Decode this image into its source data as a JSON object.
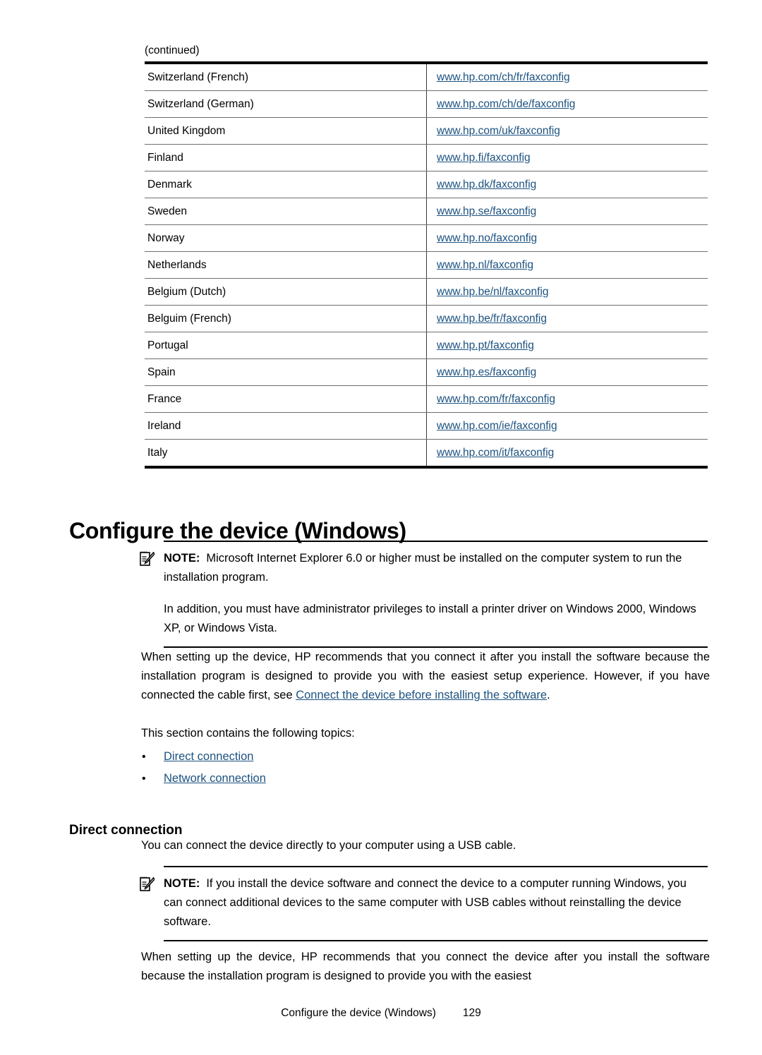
{
  "document": {
    "continued_label": "(continued)",
    "page_heading": "Configure the device (Windows)",
    "sub_heading": "Direct connection",
    "footer_title": "Configure the device (Windows)",
    "footer_page_number": "129",
    "link_color": "#1c5280",
    "text_color": "#000000",
    "background_color": "#ffffff"
  },
  "fax_table": {
    "rows": [
      {
        "country": "Switzerland (French)",
        "url": "www.hp.com/ch/fr/faxconfig"
      },
      {
        "country": "Switzerland (German)",
        "url": "www.hp.com/ch/de/faxconfig"
      },
      {
        "country": "United Kingdom",
        "url": "www.hp.com/uk/faxconfig"
      },
      {
        "country": "Finland",
        "url": "www.hp.fi/faxconfig"
      },
      {
        "country": "Denmark",
        "url": "www.hp.dk/faxconfig"
      },
      {
        "country": "Sweden",
        "url": "www.hp.se/faxconfig"
      },
      {
        "country": "Norway",
        "url": "www.hp.no/faxconfig"
      },
      {
        "country": "Netherlands",
        "url": "www.hp.nl/faxconfig"
      },
      {
        "country": "Belgium (Dutch)",
        "url": "www.hp.be/nl/faxconfig"
      },
      {
        "country": "Belguim (French)",
        "url": "www.hp.be/fr/faxconfig"
      },
      {
        "country": "Portugal",
        "url": "www.hp.pt/faxconfig"
      },
      {
        "country": "Spain",
        "url": "www.hp.es/faxconfig"
      },
      {
        "country": "France",
        "url": "www.hp.com/fr/faxconfig"
      },
      {
        "country": "Ireland",
        "url": "www.hp.com/ie/faxconfig"
      },
      {
        "country": "Italy",
        "url": "www.hp.com/it/faxconfig"
      }
    ]
  },
  "note_one": {
    "icon": "note-pencil-icon",
    "label": "NOTE:",
    "paragraph_1": "Microsoft Internet Explorer 6.0 or higher must be installed on the computer system to run the installation program.",
    "paragraph_2": "In addition, you must have administrator privileges to install a printer driver on Windows 2000, Windows XP, or Windows Vista."
  },
  "intro": {
    "text_before_link": "When setting up the device, HP recommends that you connect it after you install the software because the installation program is designed to provide you with the easiest setup experience. However, if you have connected the cable first, see ",
    "link_text": "Connect the device before installing the software",
    "text_after_link": ".",
    "topics_intro": "This section contains the following topics:"
  },
  "topics": {
    "bullet_glyph": "•",
    "items": [
      {
        "label": "Direct connection"
      },
      {
        "label": "Network connection"
      }
    ]
  },
  "direct_connection": {
    "intro": "You can connect the device directly to your computer using a USB cable.",
    "closing": "When setting up the device, HP recommends that you connect the device after you install the software because the installation program is designed to provide you with the easiest"
  },
  "note_two": {
    "icon": "note-pencil-icon",
    "label": "NOTE:",
    "paragraph_1": "If you install the device software and connect the device to a computer running Windows, you can connect additional devices to the same computer with USB cables without reinstalling the device software."
  }
}
